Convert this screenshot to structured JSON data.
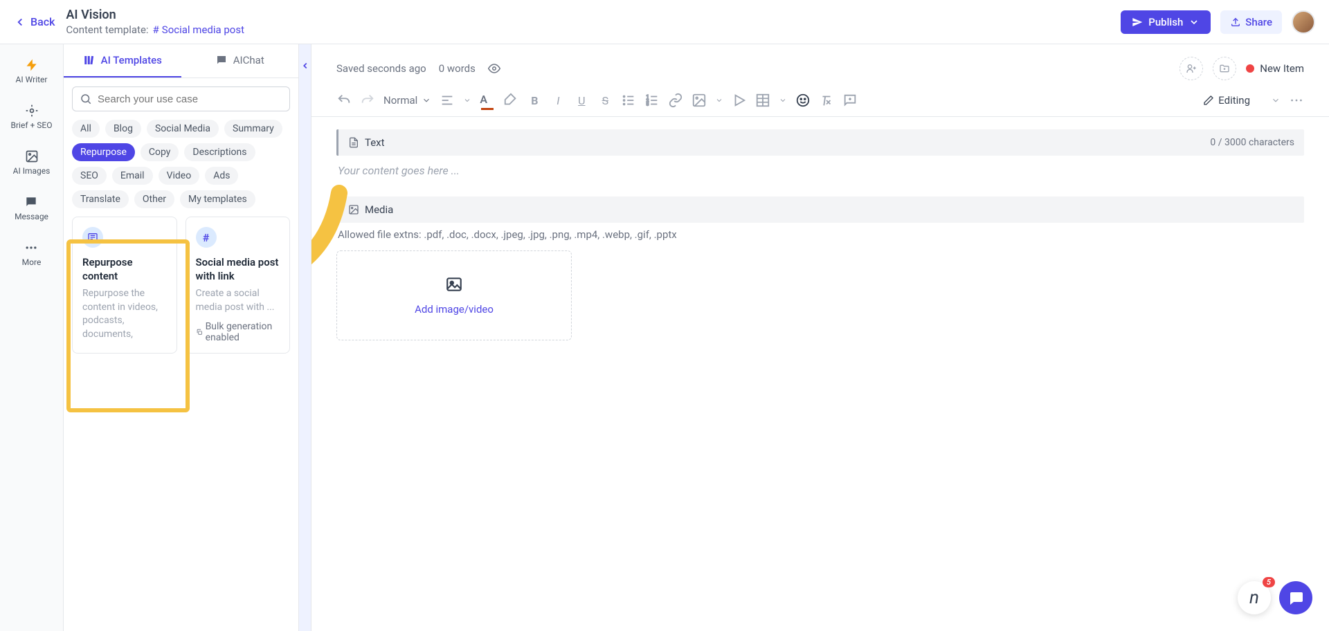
{
  "header": {
    "back": "Back",
    "title": "AI Vision",
    "template_label": "Content template:",
    "template_name": "Social media post",
    "publish": "Publish",
    "share": "Share"
  },
  "rail": {
    "items": [
      {
        "label": "AI Writer"
      },
      {
        "label": "Brief + SEO"
      },
      {
        "label": "AI Images"
      },
      {
        "label": "Message"
      },
      {
        "label": "More"
      }
    ]
  },
  "sidebar": {
    "tabs": {
      "templates": "AI Templates",
      "chat": "AIChat"
    },
    "search_placeholder": "Search your use case",
    "chips": [
      "All",
      "Blog",
      "Social Media",
      "Summary",
      "Repurpose",
      "Copy",
      "Descriptions",
      "SEO",
      "Email",
      "Video",
      "Ads",
      "Translate",
      "Other",
      "My templates"
    ],
    "active_chip": "Repurpose",
    "cards": [
      {
        "title": "Repurpose content",
        "desc": "Repurpose the content in videos, podcasts, documents,"
      },
      {
        "title": "Social media post with link",
        "desc": "Create a social media post with ...",
        "meta": "Bulk generation enabled"
      }
    ]
  },
  "editor": {
    "saved": "Saved seconds ago",
    "words": "0 words",
    "new_item": "New Item",
    "style_select": "Normal",
    "editing_label": "Editing",
    "text_block": "Text",
    "char_count": "0 / 3000 characters",
    "placeholder": "Your content goes here ...",
    "media_block": "Media",
    "allowed": "Allowed file extns: .pdf, .doc, .docx, .jpeg, .jpg, .png, .mp4, .webp, .gif, .pptx",
    "add_media": "Add image/video"
  },
  "float": {
    "badge": "5",
    "n": "n"
  }
}
